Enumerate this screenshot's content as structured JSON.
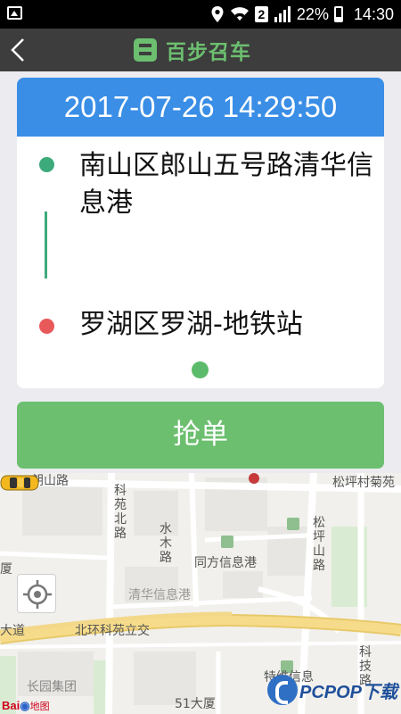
{
  "status_bar": {
    "sim": "2",
    "battery": "22%",
    "time": "14:30"
  },
  "header": {
    "brand": "百步召车"
  },
  "order": {
    "datetime": "2017-07-26 14:29:50",
    "from": "南山区郎山五号路清华信息港",
    "to": "罗湖区罗湖-地铁站"
  },
  "actions": {
    "grab_label": "抢单"
  },
  "map": {
    "labels": {
      "langshan_road": "朗山路",
      "kejian_north": "科苑北路",
      "shuimu_road": "水木路",
      "songpingshan_road": "松坪山路",
      "songping_village": "松坪村菊苑",
      "tongfang": "同方信息港",
      "qinghua": "清华信息港",
      "avenue": "大道",
      "beihuan": "北环科苑立交",
      "changyuan": "长园集团",
      "tower51": "51大厦",
      "edge_left": "厦",
      "tewei": "特维信息",
      "keji_road": "科技路"
    },
    "baidu_logo": "Bai地图",
    "watermark": "PCPOP下载"
  },
  "colors": {
    "header_bg": "#3d3d3d",
    "brand_green": "#6cbf6f",
    "date_blue": "#3a8ee6",
    "from_dot": "#3caa7a",
    "to_dot": "#e8595a"
  }
}
